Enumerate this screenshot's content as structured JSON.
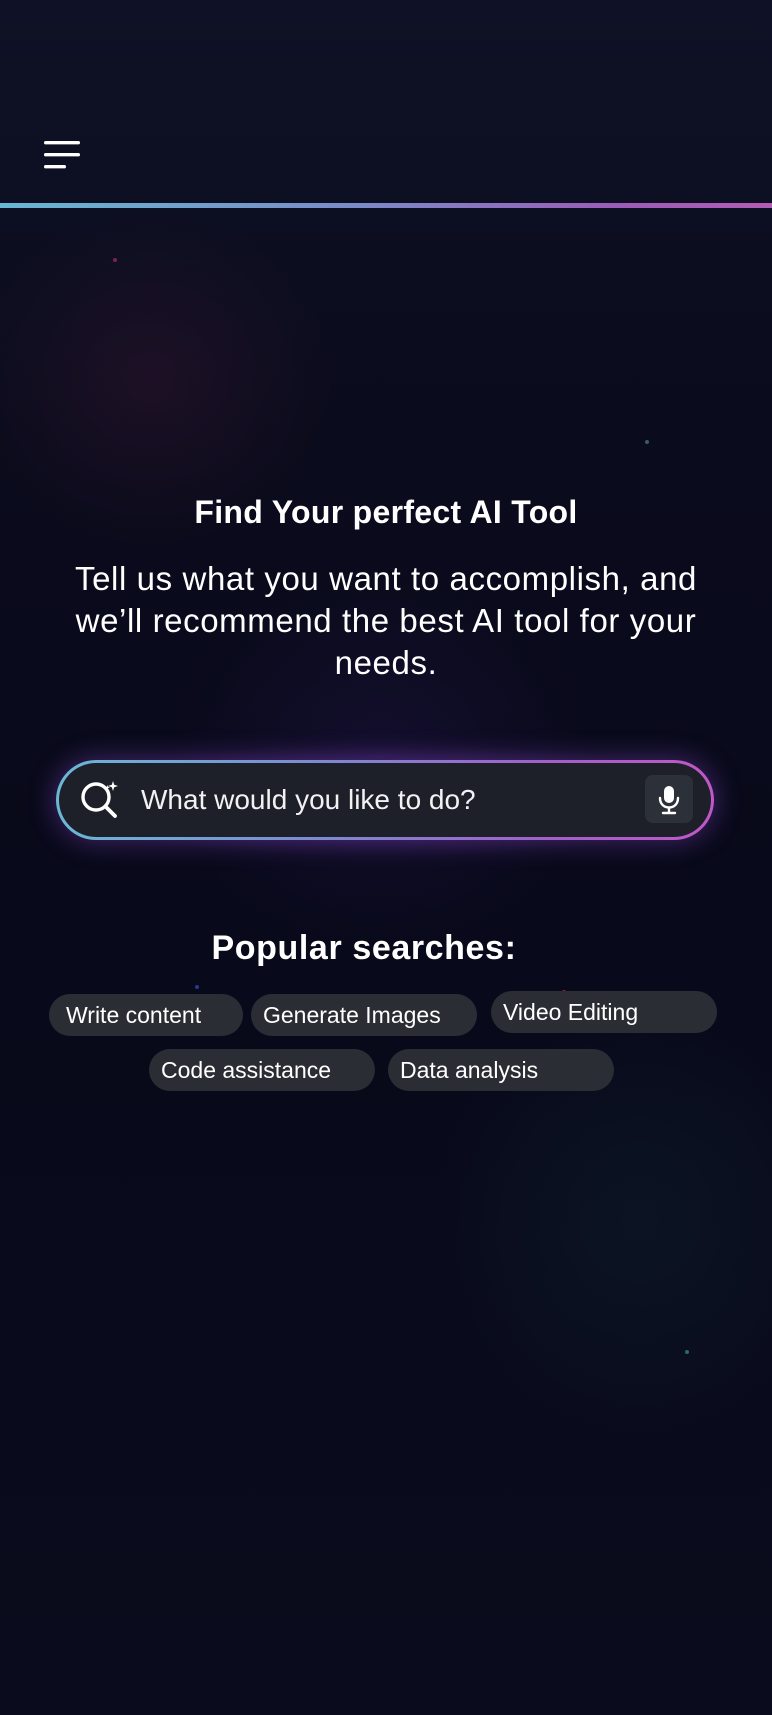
{
  "header": {
    "menu_icon": "hamburger-menu-icon",
    "divider_colors": [
      "#67b6d2",
      "#9a5cb8"
    ]
  },
  "hero": {
    "title": "Find Your perfect AI Tool",
    "subtitle": "Tell us what you want to accomplish, and we’ll recommend the best AI tool for your needs."
  },
  "search": {
    "placeholder": "What would you like to do?",
    "value": "",
    "search_icon": "ai-search-icon",
    "mic_icon": "microphone-icon",
    "border_gradient": [
      "#6bb8d6",
      "#c058c8"
    ]
  },
  "popular": {
    "title": "Popular searches:",
    "chips": [
      {
        "label": "Write content"
      },
      {
        "label": "Generate Images"
      },
      {
        "label": "Video Editing"
      },
      {
        "label": "Code assistance"
      },
      {
        "label": "Data analysis"
      }
    ]
  },
  "colors": {
    "background": "#0a0b1c",
    "chip_background": "#2b2d34",
    "search_background": "#1d2029"
  }
}
